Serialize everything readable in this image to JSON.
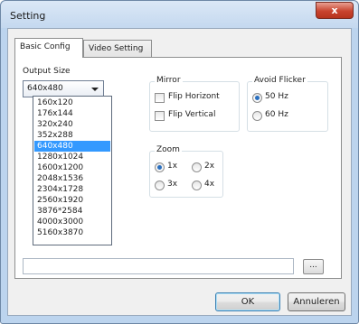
{
  "window": {
    "title": "Setting"
  },
  "title_buttons": {
    "close": "x"
  },
  "tabs": [
    {
      "label": "Basic Config",
      "active": true
    },
    {
      "label": "Video Setting",
      "active": false
    }
  ],
  "output_size": {
    "label": "Output Size",
    "selected": "640x480",
    "options": [
      "160x120",
      "176x144",
      "320x240",
      "352x288",
      "640x480",
      "1280x1024",
      "1600x1200",
      "2048x1536",
      "2304x1728",
      "2560x1920",
      "3876*2584",
      "4000x3000",
      "5160x3870"
    ]
  },
  "mirror": {
    "title": "Mirror",
    "flip_horizontal": {
      "label": "Flip Horizont",
      "checked": false
    },
    "flip_vertical": {
      "label": "Flip Vertical",
      "checked": false
    }
  },
  "avoid_flicker": {
    "title": "Avoid Flicker",
    "hz50": {
      "label": "50 Hz",
      "selected": true
    },
    "hz60": {
      "label": "60 Hz",
      "selected": false
    }
  },
  "zoom": {
    "title": "Zoom",
    "x1": {
      "label": "1x",
      "selected": true
    },
    "x2": {
      "label": "2x",
      "selected": false
    },
    "x3": {
      "label": "3x",
      "selected": false
    },
    "x4": {
      "label": "4x",
      "selected": false
    }
  },
  "path": {
    "value": "",
    "browse_label": "..."
  },
  "buttons": {
    "ok": "OK",
    "cancel": "Annuleren"
  },
  "colors": {
    "selection": "#3399ff",
    "radio_dot": "#2a6fbf",
    "close_button": "#c8432e"
  }
}
